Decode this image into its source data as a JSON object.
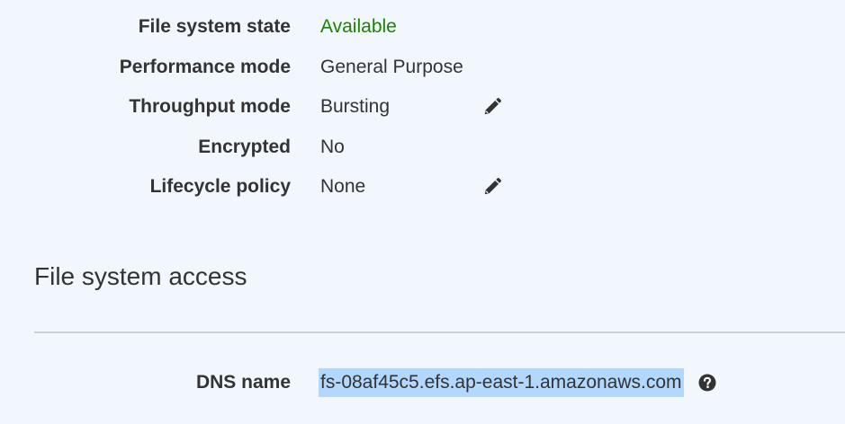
{
  "details": [
    {
      "label": "File system state",
      "value": "Available",
      "status": "ok",
      "editable": false
    },
    {
      "label": "Performance mode",
      "value": "General Purpose",
      "editable": false
    },
    {
      "label": "Throughput mode",
      "value": "Bursting",
      "editable": true
    },
    {
      "label": "Encrypted",
      "value": "No",
      "editable": false
    },
    {
      "label": "Lifecycle policy",
      "value": "None",
      "editable": true
    }
  ],
  "access": {
    "title": "File system access",
    "dns_label": "DNS name",
    "dns_value": "fs-08af45c5.efs.ap-east-1.amazonaws.com"
  },
  "icons": {
    "edit": "pencil-icon",
    "help": "question-circle-icon"
  },
  "colors": {
    "status_ok": "#1d8102",
    "selection": "#b3d7fd",
    "background": "#f1f7fd"
  }
}
